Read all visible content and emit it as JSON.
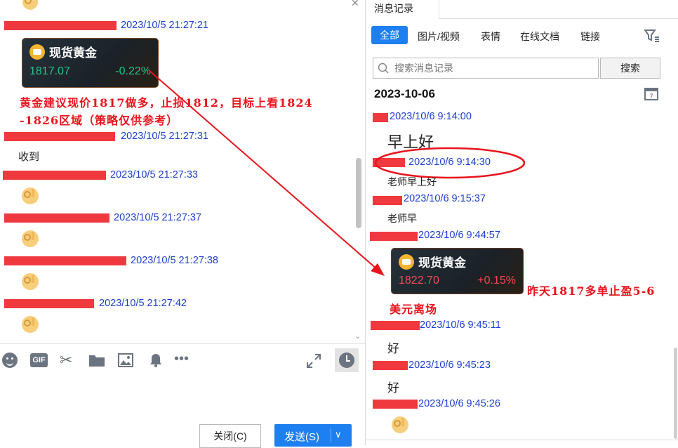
{
  "chat": {
    "messages": [
      {
        "ts": "2023/10/5 21:27:21"
      },
      {
        "ts": "2023/10/5 21:27:31",
        "text": "收到"
      },
      {
        "ts": "2023/10/5 21:27:33"
      },
      {
        "ts": "2023/10/5 21:27:37"
      },
      {
        "ts": "2023/10/5 21:27:38"
      },
      {
        "ts": "2023/10/5 21:27:42"
      }
    ],
    "card": {
      "title": "现货黄金",
      "price": "1817.07",
      "change": "-0.22%",
      "change_color": "#2bbf8a"
    },
    "annotation_line1": "黄金建议现价1817做多，止损1812，目标上看1824",
    "annotation_line2": "-1826区域（策略仅供参考）",
    "toolbar": {
      "icons": [
        "emoji-icon",
        "gif-icon",
        "scissors-icon",
        "folder-icon",
        "image-icon",
        "bell-icon",
        "more-icon"
      ],
      "gif_label": "GIF",
      "expand_icon": "expand-icon",
      "history_icon": "clock-icon"
    },
    "close_button": "关闭(C)",
    "send_button": "发送(S)"
  },
  "history": {
    "tab_label": "消息记录",
    "filters": [
      "全部",
      "图片/视频",
      "表情",
      "在线文档",
      "链接"
    ],
    "active_filter": "全部",
    "search_placeholder": "搜索消息记录",
    "search_button": "搜索",
    "date_header": "2023-10-06",
    "entries": [
      {
        "ts": "2023/10/6 9:14:00",
        "text": "早上好"
      },
      {
        "ts": "2023/10/6 9:14:30",
        "text": "老师早上好"
      },
      {
        "ts": "2023/10/6 9:15:37",
        "text": "老师早"
      },
      {
        "ts": "2023/10/6 9:44:57"
      },
      {
        "ts": "2023/10/6 9:45:11",
        "text": "好"
      },
      {
        "ts": "2023/10/6 9:45:23",
        "text": "好"
      },
      {
        "ts": "2023/10/6 9:45:26"
      }
    ],
    "card": {
      "title": "现货黄金",
      "price": "1822.70",
      "change": "+0.15%",
      "change_color": "#f04a5a"
    },
    "annotation_line1": "昨天1817多单止盈5-6",
    "annotation_line2": "美元离场"
  },
  "colors": {
    "accent": "#1d7ff0",
    "timestamp": "#1a3fd0",
    "annotation": "#e8141c",
    "redaction": "#f0393f"
  }
}
